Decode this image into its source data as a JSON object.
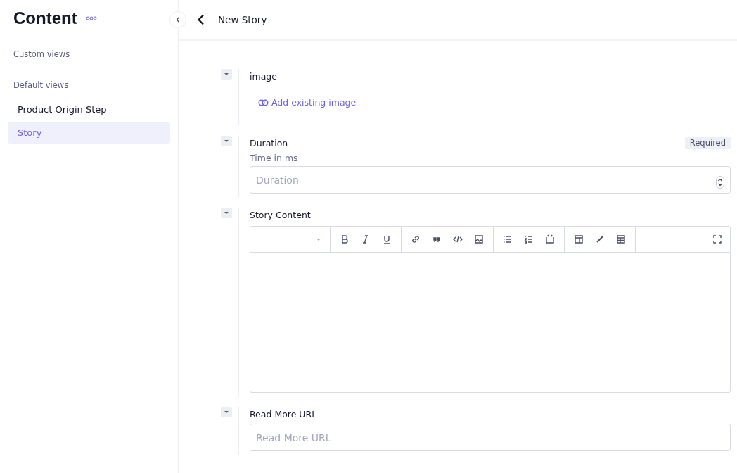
{
  "sidebar": {
    "title": "Content",
    "sections": [
      {
        "heading": "Custom views"
      },
      {
        "heading": "Default views",
        "items": [
          {
            "label": "Product Origin Step",
            "selected": false
          },
          {
            "label": "Story",
            "selected": true
          }
        ]
      }
    ]
  },
  "header": {
    "title": "New Story"
  },
  "fields": [
    {
      "kind": "relation",
      "label": "image",
      "action": "Add existing image"
    },
    {
      "kind": "number",
      "label": "Duration",
      "badge": "Required",
      "hint": "Time in ms",
      "placeholder": "Duration"
    },
    {
      "kind": "richtext",
      "label": "Story Content"
    },
    {
      "kind": "text",
      "label": "Read More URL",
      "placeholder": "Read More URL"
    }
  ]
}
